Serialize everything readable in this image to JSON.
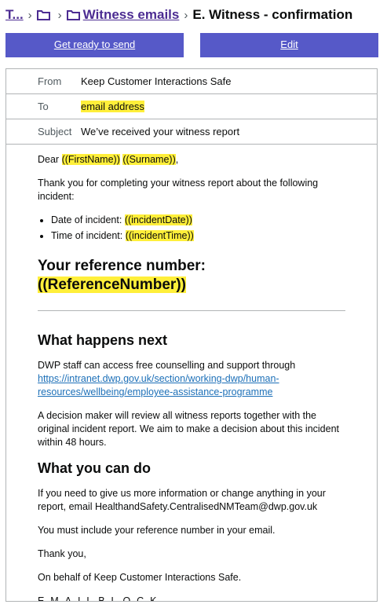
{
  "breadcrumb": {
    "root_label": "T...",
    "witness_emails_label": "Witness emails",
    "current_label": "E. Witness - confirmation"
  },
  "actions": {
    "send_label": "Get ready to send",
    "edit_label": "Edit"
  },
  "email": {
    "from_label": "From",
    "from_value": "Keep Customer Interactions Safe",
    "to_label": "To",
    "to_value": "email address",
    "subject_label": "Subject",
    "subject_value": "We’ve received your witness report",
    "greeting_prefix": "Dear ",
    "first_name_placeholder": "((FirstName))",
    "surname_placeholder": "((Surname))",
    "greeting_suffix": ",",
    "intro": "Thank you for completing your witness report about the following incident:",
    "date_label": "Date of incident: ",
    "date_placeholder": "((incidentDate))",
    "time_label": "Time of incident: ",
    "time_placeholder": "((incidentTime))",
    "reference_label": "Your reference number: ",
    "reference_placeholder": "((ReferenceNumber))",
    "what_next_heading": "What happens next",
    "support_text": "DWP staff can access free counselling and support through",
    "support_link": "https://intranet.dwp.gov.uk/section/working-dwp/human-resources/wellbeing/employee-assistance-programme",
    "decision_text": "A decision maker will review all witness reports together with the original incident report. We aim to make a decision about this incident within 48 hours.",
    "what_you_can_do_heading": "What you can do",
    "more_info_text": "If you need to give us more information or change anything in your report, email HealthandSafety.CentralisedNMTeam@dwp.gov.uk",
    "include_ref_text": "You must include your reference number in your email.",
    "thank_you": "Thank you,",
    "sign_off": "On behalf of Keep Customer Interactions Safe.",
    "email_block": "E_M_A_I_L_B_L_O_C_K"
  }
}
